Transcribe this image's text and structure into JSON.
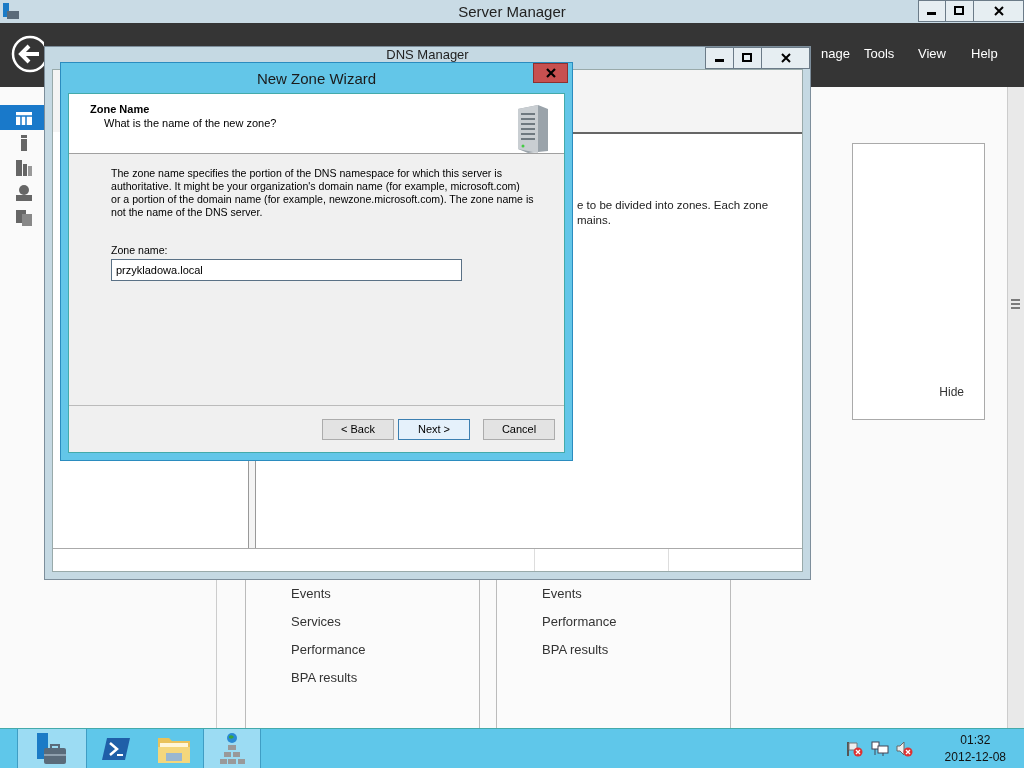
{
  "server_manager": {
    "title": "Server Manager",
    "menu": [
      "nage",
      "Tools",
      "View",
      "Help"
    ],
    "sidebar": {
      "items": [
        {
          "selected": true
        },
        {
          "selected": false
        },
        {
          "selected": false
        },
        {
          "selected": false
        },
        {
          "selected": false
        }
      ]
    },
    "hide_link": "Hide",
    "tiles": [
      {
        "links": [
          "Events",
          "Services",
          "Performance",
          "BPA results"
        ]
      },
      {
        "links": [
          "Events",
          "Performance",
          "BPA results"
        ]
      }
    ]
  },
  "dns_manager": {
    "title": "DNS Manager",
    "description_lines": [
      "e to be divided into zones. Each zone",
      "mains."
    ]
  },
  "wizard": {
    "title": "New Zone Wizard",
    "heading": "Zone Name",
    "subheading": "What is the name of the new zone?",
    "description_lines": [
      "The zone name specifies the portion of the DNS namespace for which this server is",
      "authoritative. It might be your organization's domain name (for example,  microsoft.com)",
      "or a portion of the domain name (for example, newzone.microsoft.com). The zone name is",
      "not the name of the DNS server."
    ],
    "field_label": "Zone name:",
    "zone_name": "przykladowa.local",
    "buttons": [
      {
        "label": "< Back",
        "focused": false
      },
      {
        "label": "Next >",
        "focused": true
      },
      {
        "label": "Cancel",
        "focused": false
      }
    ]
  },
  "taskbar": {
    "apps": [
      {
        "kind": "server-manager",
        "active": true
      },
      {
        "kind": "powershell",
        "active": false
      },
      {
        "kind": "explorer",
        "active": false
      },
      {
        "kind": "dns",
        "active": true
      }
    ],
    "clock": {
      "time": "01:32",
      "date": "2012-12-08"
    }
  }
}
